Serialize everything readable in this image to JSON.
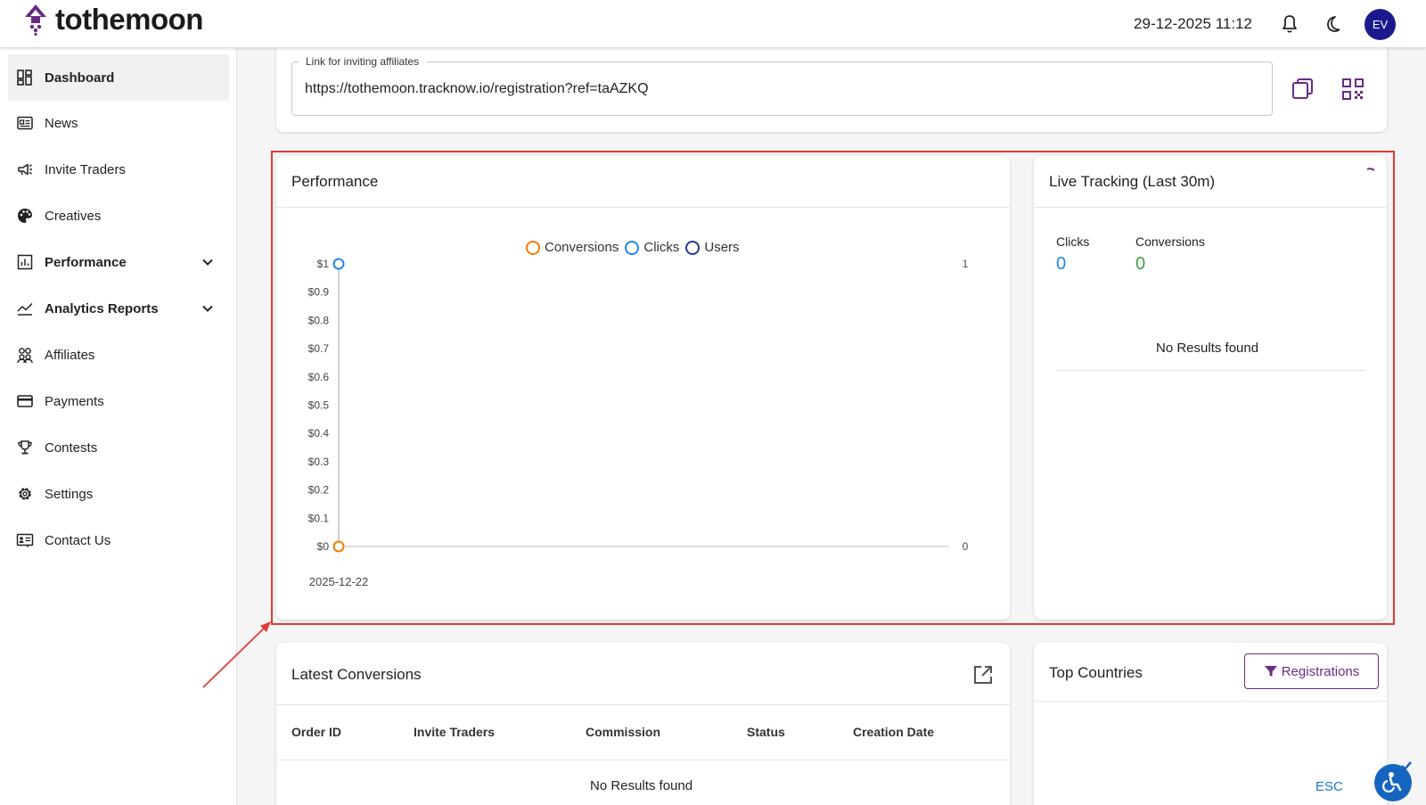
{
  "header": {
    "logo_text": "tothemoon",
    "datetime": "29-12-2025 11:12",
    "avatar_initials": "EV"
  },
  "sidebar": {
    "items": [
      {
        "label": "Dashboard",
        "icon": "dashboard-icon",
        "active": true
      },
      {
        "label": "News",
        "icon": "news-icon"
      },
      {
        "label": "Invite Traders",
        "icon": "megaphone-icon"
      },
      {
        "label": "Creatives",
        "icon": "palette-icon"
      },
      {
        "label": "Performance",
        "icon": "bar-chart-icon",
        "expandable": true
      },
      {
        "label": "Analytics Reports",
        "icon": "trend-line-icon",
        "expandable": true
      },
      {
        "label": "Affiliates",
        "icon": "people-icon"
      },
      {
        "label": "Payments",
        "icon": "card-icon"
      },
      {
        "label": "Contests",
        "icon": "trophy-icon"
      },
      {
        "label": "Settings",
        "icon": "gear-icon"
      },
      {
        "label": "Contact Us",
        "icon": "contact-icon"
      }
    ]
  },
  "invite": {
    "legend": "Link for inviting affiliates",
    "url": "https://tothemoon.tracknow.io/registration?ref=taAZKQ"
  },
  "performance": {
    "title": "Performance"
  },
  "chart_data": {
    "type": "line",
    "x": [
      "2025-12-22"
    ],
    "series": [
      {
        "name": "Conversions",
        "values": [
          0
        ],
        "color": "#f57c00",
        "axis": "left"
      },
      {
        "name": "Clicks",
        "values": [
          1
        ],
        "color": "#1e88e5",
        "axis": "right"
      },
      {
        "name": "Users",
        "values": [
          null
        ],
        "color": "#283593",
        "axis": "right"
      }
    ],
    "ylim": [
      0,
      1
    ],
    "y_ticks": [
      "$0",
      "$0.1",
      "$0.2",
      "$0.3",
      "$0.4",
      "$0.5",
      "$0.6",
      "$0.7",
      "$0.8",
      "$0.9",
      "$1"
    ],
    "y2_ticks": [
      "0",
      "1"
    ],
    "legend": "top-center",
    "grid": false
  },
  "live_tracking": {
    "title": "Live Tracking (Last 30m)",
    "clicks_label": "Clicks",
    "clicks_value": "0",
    "conversions_label": "Conversions",
    "conversions_value": "0",
    "empty_text": "No Results found",
    "clicks_color": "#1e88e5",
    "conversions_color": "#43a047"
  },
  "latest_conversions": {
    "title": "Latest Conversions",
    "columns": [
      "Order ID",
      "Invite Traders",
      "Commission",
      "Status",
      "Creation Date"
    ],
    "empty_text": "No Results found"
  },
  "top_countries": {
    "title": "Top Countries",
    "filter_label": "Registrations"
  },
  "misc": {
    "esc_label": "ESC"
  },
  "colors": {
    "brand": "#6a2a84",
    "highlight": "#e53935"
  }
}
